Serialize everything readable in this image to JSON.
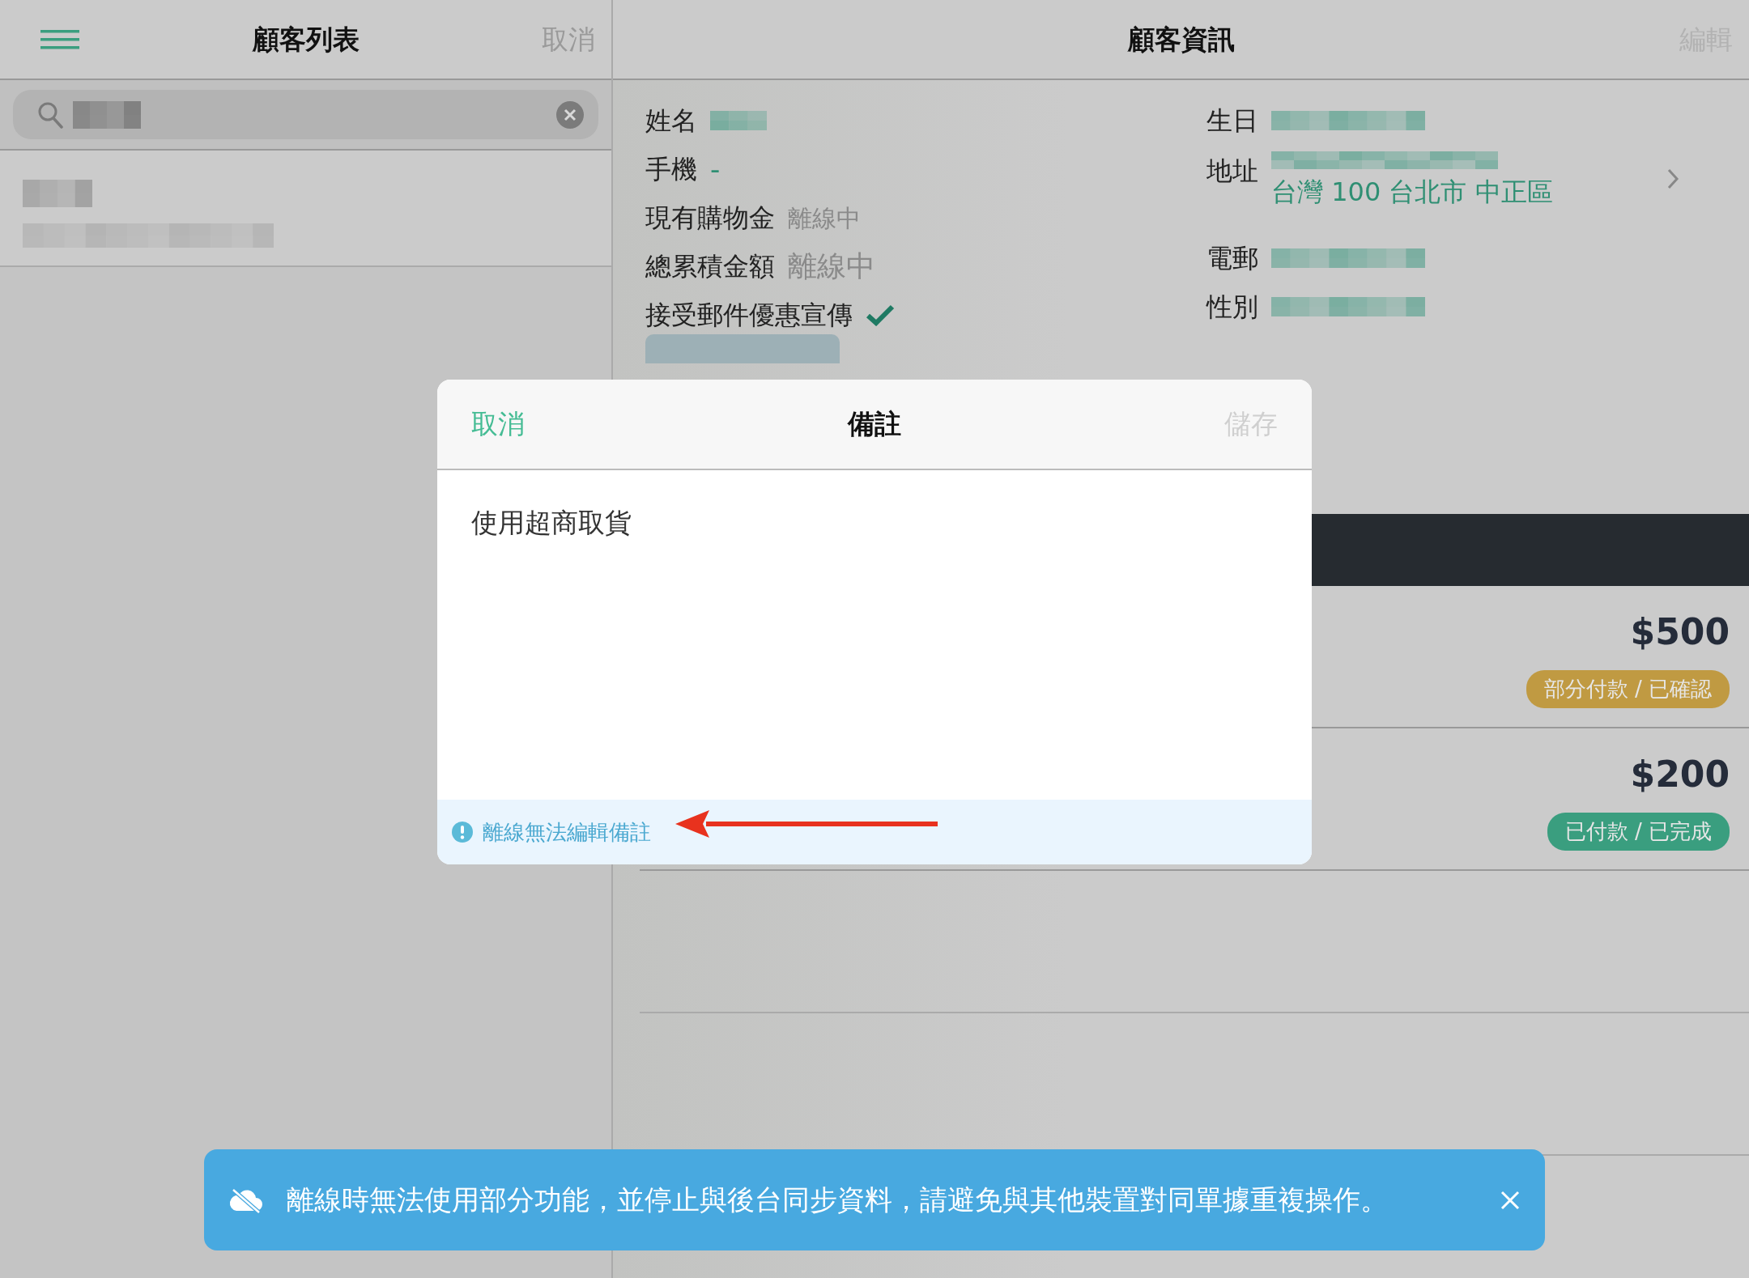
{
  "customer_list": {
    "title": "顧客列表",
    "cancel": {
      "label": "取消",
      "disabled": true
    }
  },
  "customer_info": {
    "title": "顧客資訊",
    "edit": {
      "label": "編輯",
      "disabled": true
    },
    "name": {
      "label": "姓名"
    },
    "mobile": {
      "label": "手機",
      "value": "-"
    },
    "store_credit": {
      "label": "現有購物金",
      "value": "離線中"
    },
    "total_spent": {
      "label": "總累積金額",
      "value": "離線中"
    },
    "marketing_opt_in": {
      "label": "接受郵件優惠宣傳",
      "checked": true
    },
    "birthday": {
      "label": "生日"
    },
    "address": {
      "label": "地址",
      "value": "台灣 100 台北市 中正區"
    },
    "email": {
      "label": "電郵"
    },
    "gender": {
      "label": "性別"
    }
  },
  "orders": [
    {
      "amount": "$500",
      "status": "部分付款 / 已確認",
      "color": "#c09a42"
    },
    {
      "amount": "$200",
      "status": "已付款 / 已完成",
      "color": "#3a9e7f"
    }
  ],
  "note_dialog": {
    "cancel": {
      "label": "取消",
      "disabled": false
    },
    "title": "備註",
    "save": {
      "label": "儲存",
      "disabled": true
    },
    "note": "使用超商取貨",
    "warning": "離線無法編輯備註"
  },
  "offline_banner": {
    "message": "離線時無法使用部分功能，並停止與後台同步資料，請避免與其他裝置對同單據重複操作。"
  }
}
